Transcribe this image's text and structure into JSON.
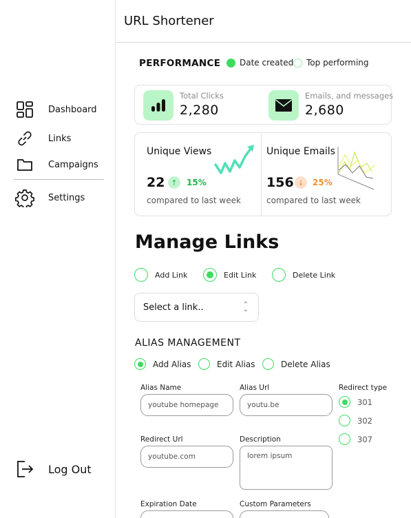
{
  "app": {
    "title": "URL Shortener"
  },
  "sidebar": {
    "items": [
      {
        "label": "Dashboard",
        "icon": "dashboard-grid-icon"
      },
      {
        "label": "Links",
        "icon": "link-icon"
      },
      {
        "label": "Campaigns",
        "icon": "folder-icon"
      },
      {
        "label": "Settings",
        "icon": "gear-icon"
      }
    ],
    "logout": {
      "label": "Log Out",
      "icon": "logout-icon"
    }
  },
  "performance": {
    "title": "PERFORMANCE",
    "toggles": [
      {
        "label": "Date created",
        "selected": true
      },
      {
        "label": "Top performing",
        "selected": false
      }
    ],
    "stats": [
      {
        "label": "Total Clicks",
        "value": "2,280",
        "icon": "bar-chart-icon"
      },
      {
        "label": "Emails, and messages",
        "value": "2,680",
        "icon": "envelope-icon"
      }
    ],
    "metrics": [
      {
        "title": "Unique Views",
        "value": "22",
        "change": "15%",
        "direction": "up",
        "compare": "compared to last week",
        "color": "#1db84a"
      },
      {
        "title": "Unique Emails",
        "value": "156",
        "change": "25%",
        "direction": "down",
        "compare": "compared to last week",
        "color": "#f0922b"
      }
    ]
  },
  "manage_links": {
    "title": "Manage Links",
    "actions": [
      {
        "label": "Add Link",
        "selected": false
      },
      {
        "label": "Edit Link",
        "selected": true
      },
      {
        "label": "Delete Link",
        "selected": false
      }
    ],
    "select_placeholder": "Select a link.."
  },
  "alias": {
    "title": "ALIAS MANAGEMENT",
    "actions": [
      {
        "label": "Add Alias",
        "selected": true
      },
      {
        "label": "Edit Alias",
        "selected": false
      },
      {
        "label": "Delete Alias",
        "selected": false
      }
    ],
    "fields": {
      "alias_name": {
        "label": "Alias Name",
        "placeholder": "youtube homepage"
      },
      "alias_url": {
        "label": "Alias Url",
        "placeholder": "youtu.be"
      },
      "redirect_url": {
        "label": "Redirect Url",
        "placeholder": "youtube.com"
      },
      "description": {
        "label": "Description",
        "placeholder": "lorem ipsum"
      },
      "expiration_date": {
        "label": "Expiration Date"
      },
      "custom_parameters": {
        "label": "Custom Parameters"
      }
    },
    "redirect_type": {
      "label": "Redirect type",
      "options": [
        {
          "label": "301",
          "selected": true
        },
        {
          "label": "302",
          "selected": false
        },
        {
          "label": "307",
          "selected": false
        }
      ]
    }
  },
  "colors": {
    "accent": "#3ddc5f",
    "accent_soft": "#b9f5c6",
    "up": "#1db84a",
    "down": "#f0922b"
  }
}
